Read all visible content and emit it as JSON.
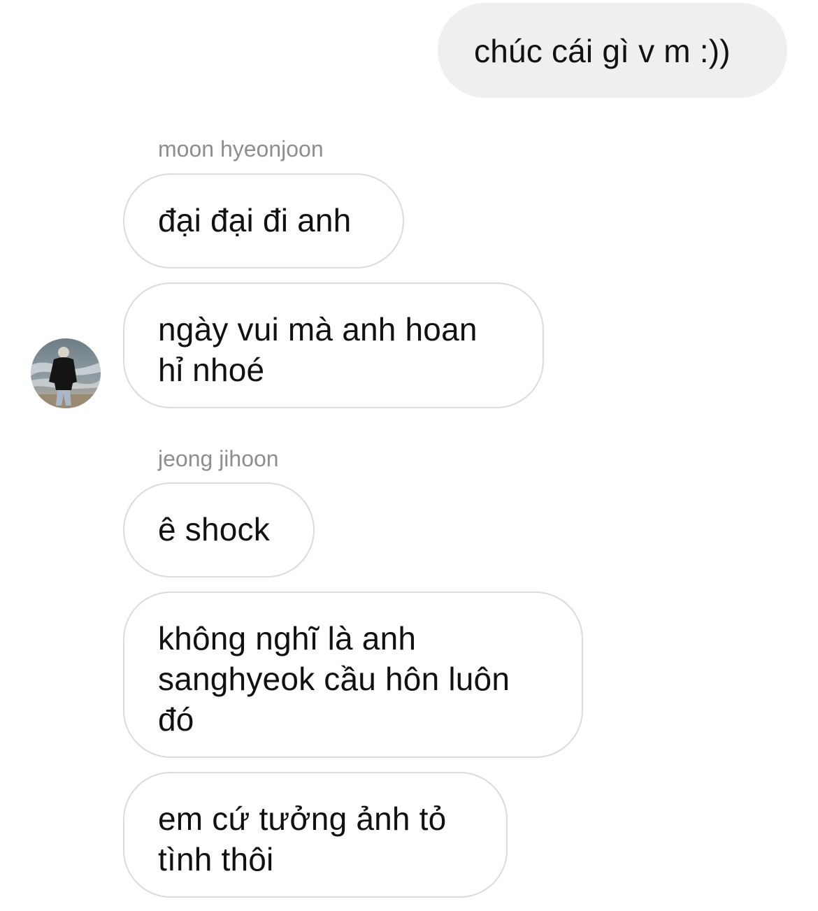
{
  "thread": {
    "outgoing": [
      {
        "text": "chúc cái gì v m :))"
      }
    ],
    "groups": [
      {
        "sender": "moon hyeonjoon",
        "avatar_icon": "user-avatar-photo",
        "messages": [
          {
            "text": "đại đại đi anh"
          },
          {
            "text": "ngày vui mà anh hoan hỉ nhoé"
          }
        ]
      },
      {
        "sender": "jeong jihoon",
        "messages": [
          {
            "text": "ê shock"
          },
          {
            "text": "không nghĩ là anh sanghyeok cầu hôn luôn đó"
          },
          {
            "text": "em cứ tưởng ảnh tỏ tình thôi"
          }
        ]
      }
    ]
  },
  "colors": {
    "outgoing_bubble": "#efefef",
    "incoming_border": "#dbdbdb",
    "sender_name": "#8e8e8e",
    "text": "#111111"
  }
}
